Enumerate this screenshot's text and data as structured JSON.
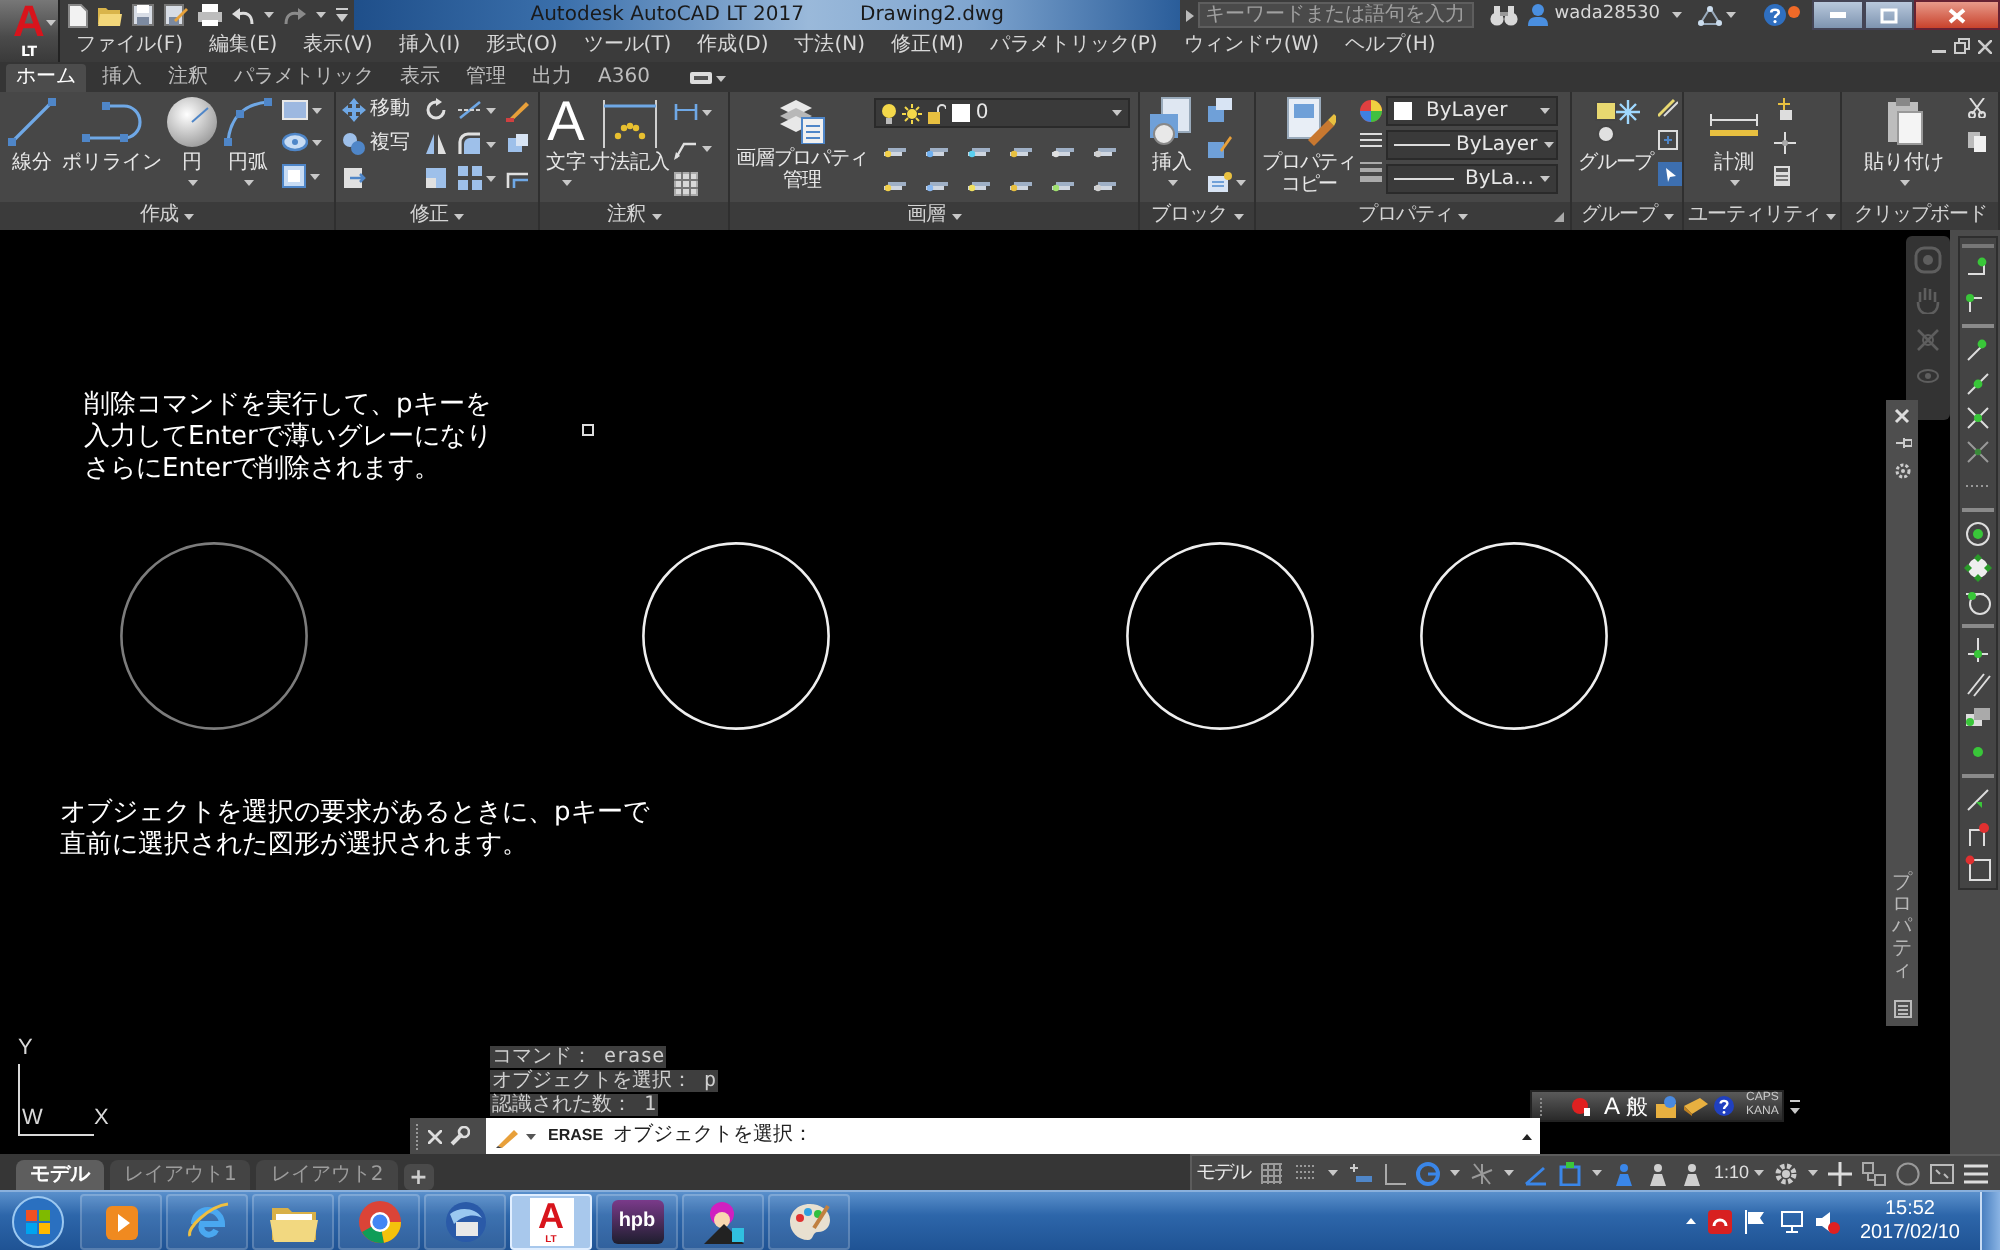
{
  "app_button": {
    "logo": "A",
    "edition": "LT"
  },
  "title_bar": {
    "title": "Autodesk AutoCAD LT 2017",
    "document": "Drawing2.dwg",
    "search": {
      "placeholder": "キーワードまたは語句を入力"
    },
    "user": "wada28530"
  },
  "menu_bar": [
    "ファイル(F)",
    "編集(E)",
    "表示(V)",
    "挿入(I)",
    "形式(O)",
    "ツール(T)",
    "作成(D)",
    "寸法(N)",
    "修正(M)",
    "パラメトリック(P)",
    "ウィンドウ(W)",
    "ヘルプ(H)"
  ],
  "ribbon": {
    "tabs": [
      {
        "label": "ホーム",
        "selected": true
      },
      {
        "label": "挿入",
        "selected": false
      },
      {
        "label": "注釈",
        "selected": false
      },
      {
        "label": "パラメトリック",
        "selected": false
      },
      {
        "label": "表示",
        "selected": false
      },
      {
        "label": "管理",
        "selected": false
      },
      {
        "label": "出力",
        "selected": false
      },
      {
        "label": "A360",
        "selected": false
      }
    ],
    "draw": {
      "label": "作成",
      "line": "線分",
      "polyline": "ポリライン",
      "circle": "円",
      "arc": "円弧"
    },
    "modify": {
      "label": "修正",
      "move": "移動",
      "copy": "複写"
    },
    "annotation": {
      "label": "注釈",
      "text_glyph": "A",
      "text": "文字",
      "dimension": "寸法記入"
    },
    "layers": {
      "label": "画層",
      "layer_properties": [
        "画層プロパティ",
        "管理"
      ],
      "current_layer": "0"
    },
    "block": {
      "label": "ブロック",
      "insert": "挿入"
    },
    "properties": {
      "label": "プロパティ",
      "match_properties": [
        "プロパティ",
        "コピー"
      ],
      "color_setting": "ByLayer",
      "linetype": "ByLayer",
      "lineweight": "ByLa…"
    },
    "groups": {
      "label": "グループ",
      "group": "グループ"
    },
    "utilities": {
      "label": "ユーティリティ",
      "measure": "計測"
    },
    "clipboard": {
      "label": "クリップボード",
      "paste": "貼り付け"
    }
  },
  "drawing": {
    "notes": [
      {
        "lines": [
          "削除コマンドを実行して、pキーを",
          "入力してEnterで薄いグレーになり",
          "さらにEnterで削除されます。"
        ]
      },
      {
        "lines": [
          "オブジェクトを選択の要求があるときに、pキーで",
          "直前に選択された図形が選択されます。"
        ]
      }
    ],
    "circles": [
      {
        "selected": true
      },
      {
        "selected": false
      },
      {
        "selected": false
      },
      {
        "selected": false
      }
    ],
    "ucs": {
      "y": "Y",
      "world": "W",
      "x": "X"
    }
  },
  "properties_palette": {
    "title": "プロパティ"
  },
  "command_history": [
    "コマンド： erase",
    "オブジェクトを選択： p",
    "認識された数： 1"
  ],
  "command_line": {
    "command": "ERASE",
    "prompt": "オブジェクトを選択："
  },
  "ime_bar": {
    "mode": "A",
    "dictionary": "般",
    "caps": "CAPS",
    "kana": "KANA"
  },
  "layout_tabs": [
    {
      "label": "モデル",
      "selected": true
    },
    {
      "label": "レイアウト1",
      "selected": false
    },
    {
      "label": "レイアウト2",
      "selected": false
    }
  ],
  "new_layout": "+",
  "status_bar": {
    "space": "モデル",
    "scale": "1:10"
  },
  "taskbar": {
    "apps": [
      {
        "kind": "player",
        "active": false
      },
      {
        "kind": "ie",
        "active": false
      },
      {
        "kind": "folder",
        "active": false
      },
      {
        "kind": "chrome",
        "active": false
      },
      {
        "kind": "mail",
        "active": false
      },
      {
        "kind": "cad",
        "label": "A",
        "sublabel": "LT",
        "active": true
      },
      {
        "kind": "hpb",
        "label": "hpb",
        "active": false
      },
      {
        "kind": "drawtool",
        "active": false
      },
      {
        "kind": "paint",
        "active": false
      }
    ],
    "clock": {
      "time": "15:52",
      "date": "2017/02/10"
    }
  }
}
